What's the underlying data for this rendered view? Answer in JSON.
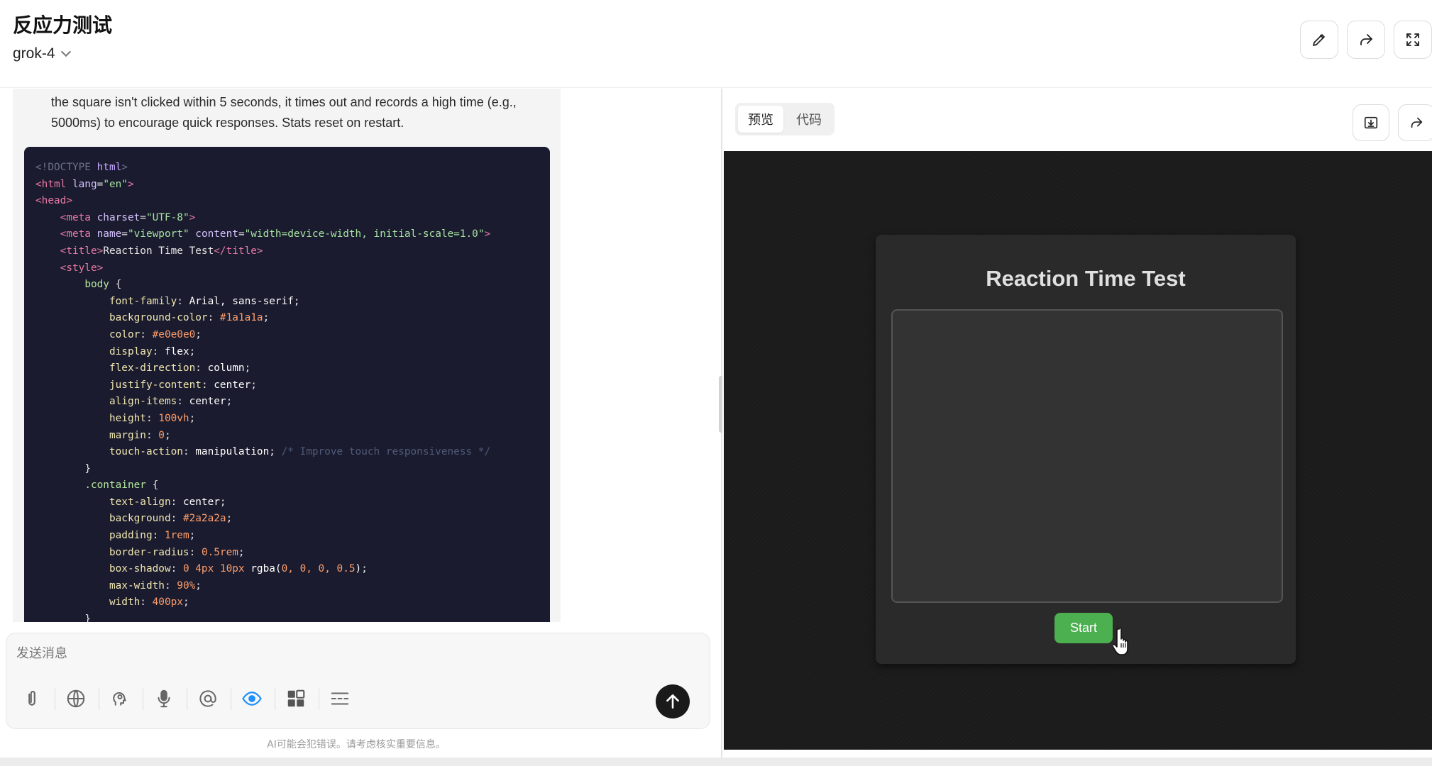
{
  "header": {
    "title": "反应力测试",
    "model": "grok-4",
    "buttons": [
      "edit-icon",
      "share-icon",
      "fullscreen-icon"
    ]
  },
  "chat": {
    "message_text": "the square isn't clicked within 5 seconds, it times out and records a high time (e.g., 5000ms) to encourage quick responses. Stats reset on restart.",
    "code_lines": [
      [
        [
          "t-mut",
          "<!DOCTYPE "
        ],
        [
          "t-name",
          "html"
        ],
        [
          "t-mut",
          ">"
        ]
      ],
      [
        [
          "t-tag",
          "<html "
        ],
        [
          "t-attr",
          "lang"
        ],
        [
          "t-pun",
          "="
        ],
        [
          "t-str",
          "\"en\""
        ],
        [
          "t-tag",
          ">"
        ]
      ],
      [
        [
          "t-tag",
          "<head>"
        ]
      ],
      [
        [
          "t-txt",
          "    "
        ],
        [
          "t-tag",
          "<meta "
        ],
        [
          "t-attr",
          "charset"
        ],
        [
          "t-pun",
          "="
        ],
        [
          "t-str",
          "\"UTF-8\""
        ],
        [
          "t-tag",
          ">"
        ]
      ],
      [
        [
          "t-txt",
          "    "
        ],
        [
          "t-tag",
          "<meta "
        ],
        [
          "t-attr",
          "name"
        ],
        [
          "t-pun",
          "="
        ],
        [
          "t-str",
          "\"viewport\" "
        ],
        [
          "t-attr",
          "content"
        ],
        [
          "t-pun",
          "="
        ],
        [
          "t-str",
          "\"width=device-width, initial-scale=1.0\""
        ],
        [
          "t-tag",
          ">"
        ]
      ],
      [
        [
          "t-txt",
          "    "
        ],
        [
          "t-tag",
          "<title>"
        ],
        [
          "t-txt",
          "Reaction Time Test"
        ],
        [
          "t-tag",
          "</title>"
        ]
      ],
      [
        [
          "t-txt",
          "    "
        ],
        [
          "t-tag",
          "<style>"
        ]
      ],
      [
        [
          "t-txt",
          "        "
        ],
        [
          "t-sel",
          "body "
        ],
        [
          "t-pun",
          "{"
        ]
      ],
      [
        [
          "t-txt",
          "            "
        ],
        [
          "t-prop",
          "font-family"
        ],
        [
          "t-pun",
          ": "
        ],
        [
          "t-val",
          "Arial, sans-serif"
        ],
        [
          "t-pun",
          ";"
        ]
      ],
      [
        [
          "t-txt",
          "            "
        ],
        [
          "t-prop",
          "background-color"
        ],
        [
          "t-pun",
          ": "
        ],
        [
          "t-num",
          "#1a1a1a"
        ],
        [
          "t-pun",
          ";"
        ]
      ],
      [
        [
          "t-txt",
          "            "
        ],
        [
          "t-prop",
          "color"
        ],
        [
          "t-pun",
          ": "
        ],
        [
          "t-num",
          "#e0e0e0"
        ],
        [
          "t-pun",
          ";"
        ]
      ],
      [
        [
          "t-txt",
          "            "
        ],
        [
          "t-prop",
          "display"
        ],
        [
          "t-pun",
          ": "
        ],
        [
          "t-val",
          "flex"
        ],
        [
          "t-pun",
          ";"
        ]
      ],
      [
        [
          "t-txt",
          "            "
        ],
        [
          "t-prop",
          "flex-direction"
        ],
        [
          "t-pun",
          ": "
        ],
        [
          "t-val",
          "column"
        ],
        [
          "t-pun",
          ";"
        ]
      ],
      [
        [
          "t-txt",
          "            "
        ],
        [
          "t-prop",
          "justify-content"
        ],
        [
          "t-pun",
          ": "
        ],
        [
          "t-val",
          "center"
        ],
        [
          "t-pun",
          ";"
        ]
      ],
      [
        [
          "t-txt",
          "            "
        ],
        [
          "t-prop",
          "align-items"
        ],
        [
          "t-pun",
          ": "
        ],
        [
          "t-val",
          "center"
        ],
        [
          "t-pun",
          ";"
        ]
      ],
      [
        [
          "t-txt",
          "            "
        ],
        [
          "t-prop",
          "height"
        ],
        [
          "t-pun",
          ": "
        ],
        [
          "t-num",
          "100vh"
        ],
        [
          "t-pun",
          ";"
        ]
      ],
      [
        [
          "t-txt",
          "            "
        ],
        [
          "t-prop",
          "margin"
        ],
        [
          "t-pun",
          ": "
        ],
        [
          "t-num",
          "0"
        ],
        [
          "t-pun",
          ";"
        ]
      ],
      [
        [
          "t-txt",
          "            "
        ],
        [
          "t-prop",
          "touch-action"
        ],
        [
          "t-pun",
          ": "
        ],
        [
          "t-val",
          "manipulation"
        ],
        [
          "t-pun",
          "; "
        ],
        [
          "t-com",
          "/* Improve touch responsiveness */"
        ]
      ],
      [
        [
          "t-txt",
          "        "
        ],
        [
          "t-pun",
          "}"
        ]
      ],
      [
        [
          "t-txt",
          "        "
        ],
        [
          "t-sel",
          ".container "
        ],
        [
          "t-pun",
          "{"
        ]
      ],
      [
        [
          "t-txt",
          "            "
        ],
        [
          "t-prop",
          "text-align"
        ],
        [
          "t-pun",
          ": "
        ],
        [
          "t-val",
          "center"
        ],
        [
          "t-pun",
          ";"
        ]
      ],
      [
        [
          "t-txt",
          "            "
        ],
        [
          "t-prop",
          "background"
        ],
        [
          "t-pun",
          ": "
        ],
        [
          "t-num",
          "#2a2a2a"
        ],
        [
          "t-pun",
          ";"
        ]
      ],
      [
        [
          "t-txt",
          "            "
        ],
        [
          "t-prop",
          "padding"
        ],
        [
          "t-pun",
          ": "
        ],
        [
          "t-num",
          "1rem"
        ],
        [
          "t-pun",
          ";"
        ]
      ],
      [
        [
          "t-txt",
          "            "
        ],
        [
          "t-prop",
          "border-radius"
        ],
        [
          "t-pun",
          ": "
        ],
        [
          "t-num",
          "0.5rem"
        ],
        [
          "t-pun",
          ";"
        ]
      ],
      [
        [
          "t-txt",
          "            "
        ],
        [
          "t-prop",
          "box-shadow"
        ],
        [
          "t-pun",
          ": "
        ],
        [
          "t-num",
          "0 4px 10px "
        ],
        [
          "t-val",
          "rgba("
        ],
        [
          "t-num",
          "0, 0, 0, 0.5"
        ],
        [
          "t-val",
          ")"
        ],
        [
          "t-pun",
          ";"
        ]
      ],
      [
        [
          "t-txt",
          "            "
        ],
        [
          "t-prop",
          "max-width"
        ],
        [
          "t-pun",
          ": "
        ],
        [
          "t-num",
          "90%"
        ],
        [
          "t-pun",
          ";"
        ]
      ],
      [
        [
          "t-txt",
          "            "
        ],
        [
          "t-prop",
          "width"
        ],
        [
          "t-pun",
          ": "
        ],
        [
          "t-num",
          "400px"
        ],
        [
          "t-pun",
          ";"
        ]
      ],
      [
        [
          "t-txt",
          "        "
        ],
        [
          "t-pun",
          "}"
        ]
      ]
    ]
  },
  "composer": {
    "placeholder": "发送消息",
    "tools": [
      "paperclip-icon",
      "globe-icon",
      "brain-icon",
      "microphone-icon",
      "at-icon",
      "eye-icon",
      "apps-icon",
      "lines-icon"
    ],
    "disclaimer": "AI可能会犯错误。请考虑核实重要信息。"
  },
  "preview_panel": {
    "tabs": [
      {
        "label": "预览",
        "active": true
      },
      {
        "label": "代码",
        "active": false
      }
    ],
    "buttons": [
      "download-icon",
      "share-icon"
    ],
    "app": {
      "title": "Reaction Time Test",
      "start_label": "Start"
    }
  },
  "colors": {
    "accent_green": "#4caf50",
    "eye_active": "#1e90ff",
    "code_bg": "#1a1b2e"
  }
}
